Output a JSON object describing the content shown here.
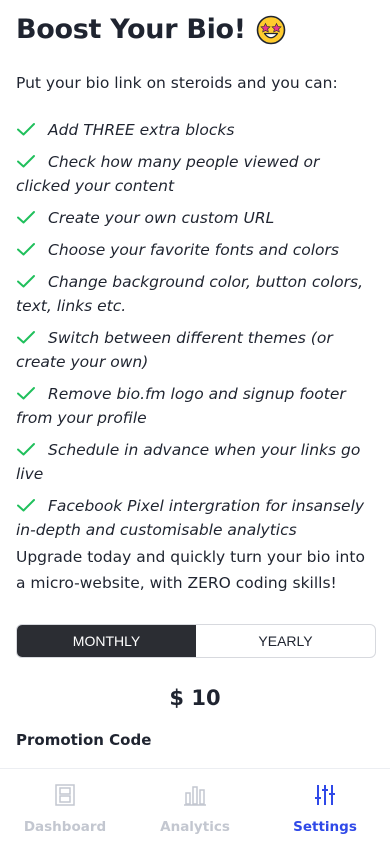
{
  "page": {
    "title": "Boost Your Bio!",
    "title_emoji": "star-struck-emoji",
    "intro": "Put your bio link on steroids and you can:",
    "features": [
      "Add THREE extra blocks",
      "Check how many people viewed or clicked your content",
      "Create your own custom URL",
      "Choose your favorite fonts and colors",
      "Change background color, button colors, text, links etc.",
      "Switch between different themes (or create your own)",
      "Remove bio.fm logo and signup footer from your profile",
      "Schedule in advance when your links go live",
      "Facebook Pixel intergration for insansely in-depth and customisable analytics"
    ],
    "upgrade_text": "Upgrade today and quickly turn your bio into a micro-website, with ZERO coding skills!",
    "billing_toggle": {
      "options": [
        "MONTHLY",
        "YEARLY"
      ],
      "selected": "MONTHLY"
    },
    "price": "$ 10",
    "promo": {
      "label": "Promotion Code",
      "value": ""
    }
  },
  "tabbar": {
    "items": [
      {
        "label": "Dashboard",
        "icon": "dashboard-icon",
        "active": false
      },
      {
        "label": "Analytics",
        "icon": "analytics-icon",
        "active": false
      },
      {
        "label": "Settings",
        "icon": "settings-sliders-icon",
        "active": true
      }
    ]
  },
  "colors": {
    "check": "#20c05c",
    "toggle_active_bg": "#2b2d33",
    "tab_active": "#2f49e8",
    "tab_inactive": "#c3c7d0"
  }
}
